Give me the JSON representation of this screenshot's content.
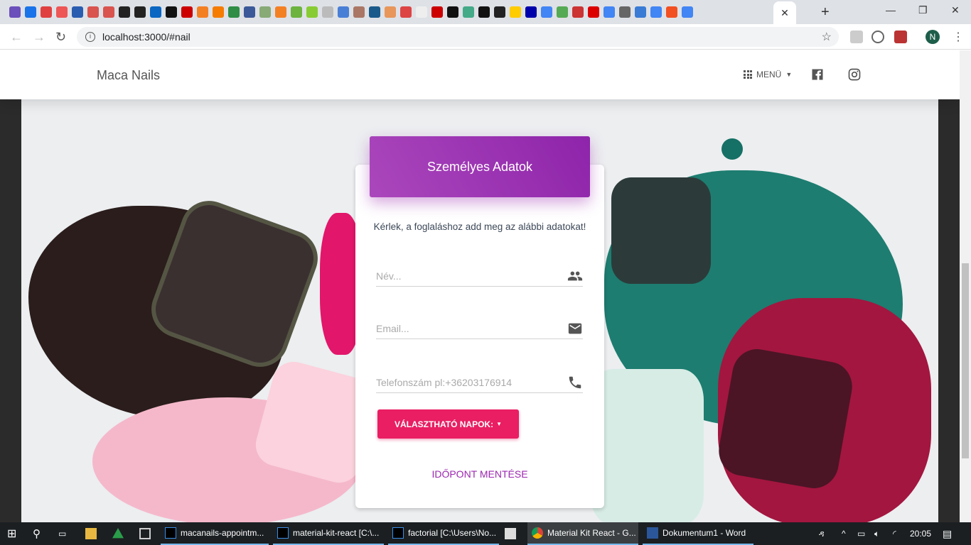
{
  "browser": {
    "url": "localhost:3000/#nail",
    "profile_initial": "N",
    "tab_close": "✕",
    "new_tab": "+",
    "active_tab_icon": "W"
  },
  "navbar": {
    "brand": "Maca Nails",
    "menu_label": "MENÜ"
  },
  "card": {
    "header": "Személyes Adatok",
    "subtitle": "Kérlek, a foglaláshoz add meg az alábbi adatokat!",
    "name_placeholder": "Név...",
    "email_placeholder": "Email...",
    "phone_placeholder": "Telefonszám pl:+36203176914",
    "dropdown_label": "VÁLASZTHATÓ NAPOK:",
    "save_label": "IDŐPONT MENTÉSE"
  },
  "taskbar": {
    "apps": [
      "macanails-appointm...",
      "material-kit-react [C:\\...",
      "factorial [C:\\Users\\No...",
      "Material Kit React - G...",
      "Dokumentum1 - Word"
    ],
    "time": "20:05"
  },
  "colors": {
    "primary": "#9c27b0",
    "rose": "#e91e63"
  }
}
